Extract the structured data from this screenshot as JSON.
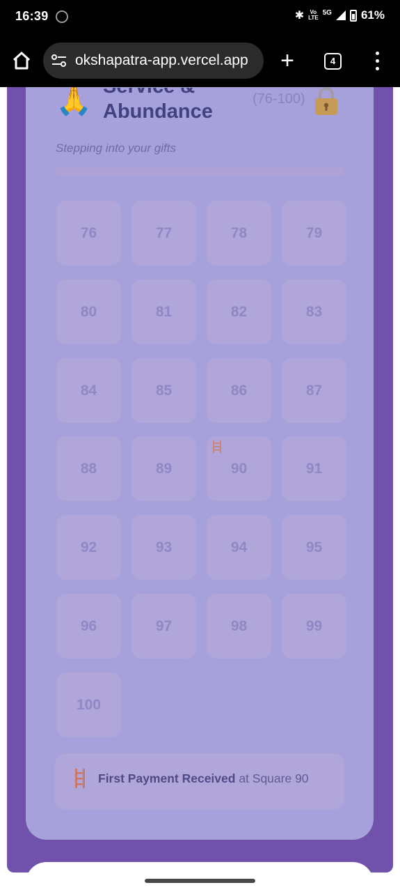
{
  "status_bar": {
    "time": "16:39",
    "lte_top": "Vo",
    "lte_bottom": "LTE",
    "network": "5G",
    "battery": "61%"
  },
  "browser": {
    "url": "okshapatra-app.vercel.app",
    "tab_count": "4"
  },
  "level": {
    "title_line_1": "Service &",
    "title_line_2": "Abundance",
    "range": "(76-100)",
    "subtitle": "Stepping into your gifts",
    "squares": [
      "76",
      "77",
      "78",
      "79",
      "80",
      "81",
      "82",
      "83",
      "84",
      "85",
      "86",
      "87",
      "88",
      "89",
      "90",
      "91",
      "92",
      "93",
      "94",
      "95",
      "96",
      "97",
      "98",
      "99",
      "100"
    ],
    "ladder_square": "90",
    "event": {
      "bold": "First Payment Received",
      "rest": " at Square 90"
    }
  },
  "colors": {
    "outer_panel": "#7051ab",
    "card": "#a6a1da",
    "tile": "#b1a6d9",
    "title": "#414181"
  }
}
